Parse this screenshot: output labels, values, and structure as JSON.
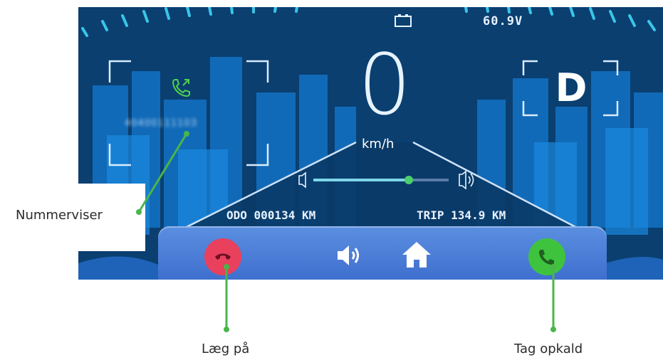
{
  "dashboard": {
    "voltage": "60.9V",
    "speed": "0",
    "speed_unit": "km/h",
    "gear": "D",
    "caller_number": "40400111103",
    "odometer": "ODO 000134 KM",
    "trip": "TRIP 134.9 KM",
    "volume_level": 0.6
  },
  "annotations": {
    "caller_id": "Nummerviser",
    "hang_up": "Læg på",
    "answer": "Tag opkald"
  },
  "colors": {
    "hangup": "#e8405d",
    "answer": "#3fc33f",
    "annotation": "#4ab54a",
    "caller_icon": "#4fd14f"
  }
}
